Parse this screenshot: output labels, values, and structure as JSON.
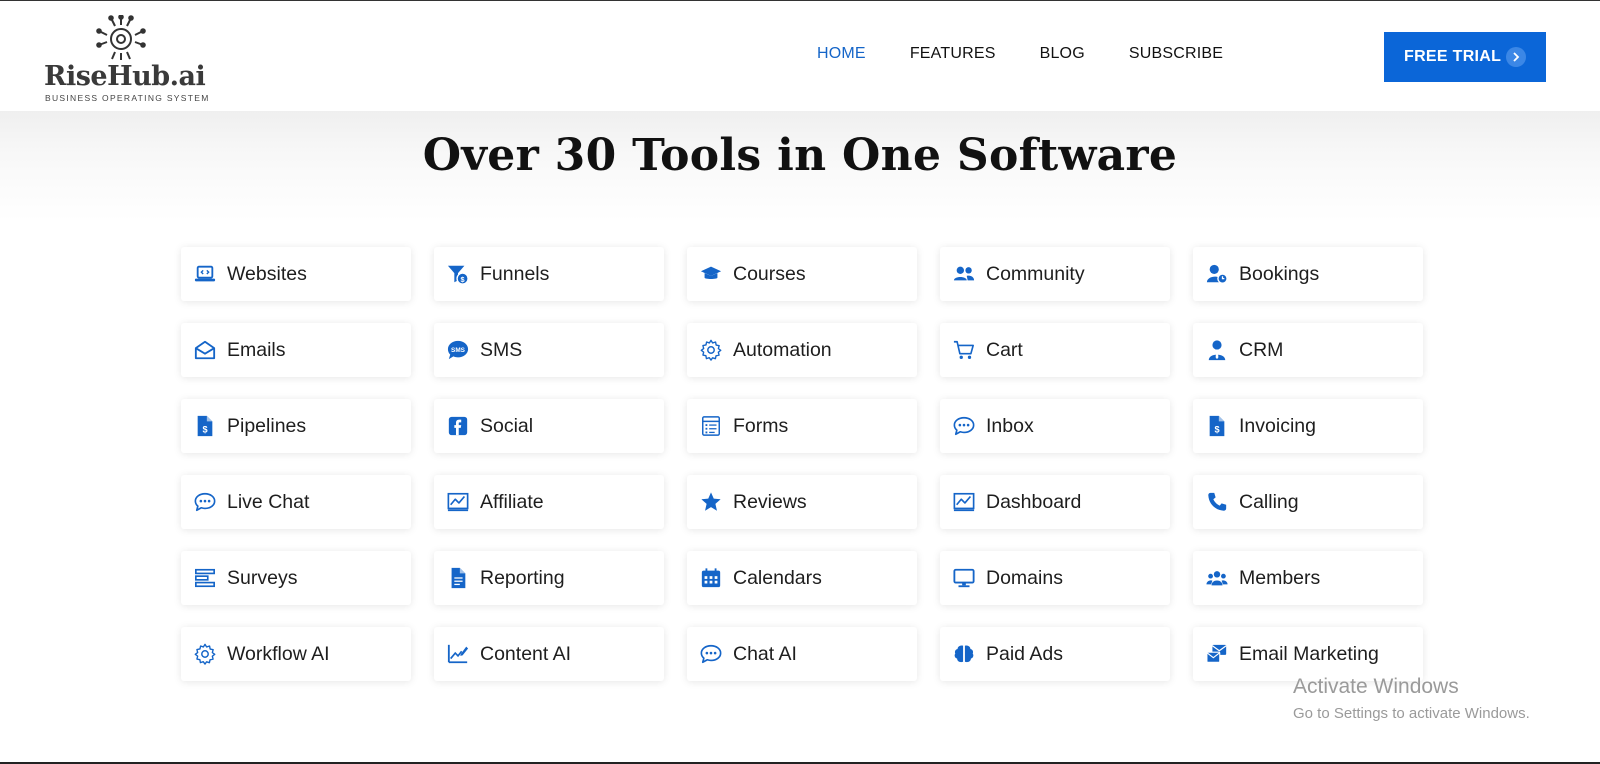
{
  "brand": {
    "name": "RiseHub.ai",
    "tagline": "BUSINESS OPERATING SYSTEM",
    "logo_icon": "circuit-gear-icon"
  },
  "nav": {
    "items": [
      {
        "label": "HOME",
        "active": true
      },
      {
        "label": "FEATURES",
        "active": false
      },
      {
        "label": "BLOG",
        "active": false
      },
      {
        "label": "SUBSCRIBE",
        "active": false
      }
    ],
    "cta_label": "FREE TRIAL"
  },
  "colors": {
    "accent": "#0b66d8",
    "nav_active": "#1565c8",
    "icon": "#1565c8"
  },
  "section": {
    "title": "Over 30 Tools in One Software"
  },
  "tools": [
    {
      "label": "Websites",
      "icon": "laptop-code-icon"
    },
    {
      "label": "Funnels",
      "icon": "funnel-dollar-icon"
    },
    {
      "label": "Courses",
      "icon": "graduation-cap-icon"
    },
    {
      "label": "Community",
      "icon": "users-icon"
    },
    {
      "label": "Bookings",
      "icon": "user-clock-icon"
    },
    {
      "label": "Emails",
      "icon": "envelope-open-icon"
    },
    {
      "label": "SMS",
      "icon": "sms-bubble-icon"
    },
    {
      "label": "Automation",
      "icon": "gear-icon"
    },
    {
      "label": "Cart",
      "icon": "cart-icon"
    },
    {
      "label": "CRM",
      "icon": "user-tie-icon"
    },
    {
      "label": "Pipelines",
      "icon": "invoice-dollar-icon"
    },
    {
      "label": "Social",
      "icon": "facebook-icon"
    },
    {
      "label": "Forms",
      "icon": "form-list-icon"
    },
    {
      "label": "Inbox",
      "icon": "chat-dots-icon"
    },
    {
      "label": "Invoicing",
      "icon": "invoice-dollar-icon"
    },
    {
      "label": "Live Chat",
      "icon": "chat-dots-icon"
    },
    {
      "label": "Affiliate",
      "icon": "chart-monitor-icon"
    },
    {
      "label": "Reviews",
      "icon": "star-icon"
    },
    {
      "label": "Dashboard",
      "icon": "chart-monitor-icon"
    },
    {
      "label": "Calling",
      "icon": "phone-icon"
    },
    {
      "label": "Surveys",
      "icon": "bars-icon"
    },
    {
      "label": "Reporting",
      "icon": "file-icon"
    },
    {
      "label": "Calendars",
      "icon": "calendar-icon"
    },
    {
      "label": "Domains",
      "icon": "desktop-icon"
    },
    {
      "label": "Members",
      "icon": "users-group-icon"
    },
    {
      "label": "Workflow AI",
      "icon": "gear-icon"
    },
    {
      "label": "Content AI",
      "icon": "chart-pen-icon"
    },
    {
      "label": "Chat AI",
      "icon": "chat-dots-icon"
    },
    {
      "label": "Paid Ads",
      "icon": "brain-icon"
    },
    {
      "label": "Email Marketing",
      "icon": "mail-bulk-icon"
    }
  ],
  "watermark": {
    "line1": "Activate Windows",
    "line2": "Go to Settings to activate Windows."
  }
}
